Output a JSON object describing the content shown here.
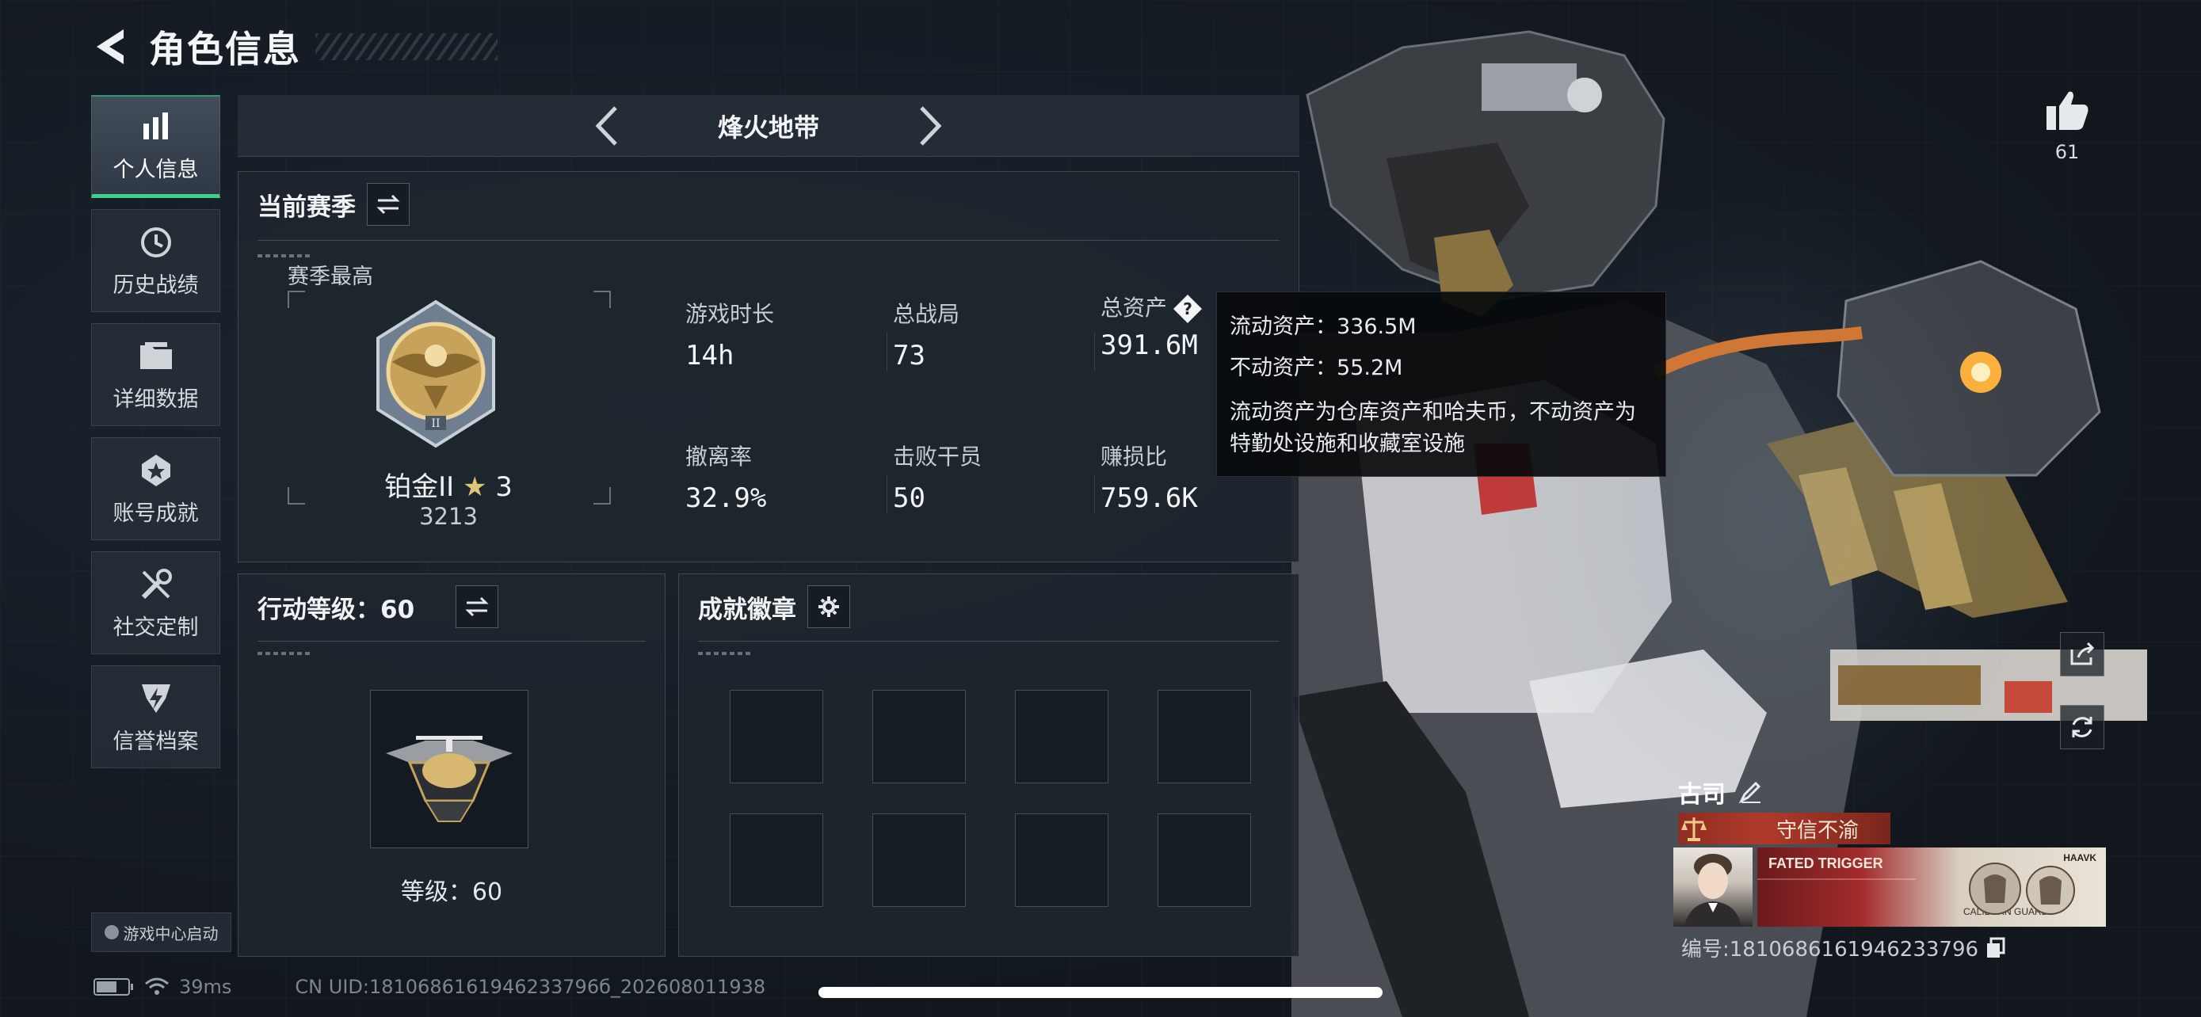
{
  "header": {
    "title": "角色信息"
  },
  "sidebar": {
    "items": [
      {
        "label": "个人信息",
        "icon": "bar-chart-icon",
        "active": true
      },
      {
        "label": "历史战绩",
        "icon": "history-clock-icon"
      },
      {
        "label": "详细数据",
        "icon": "folder-icon"
      },
      {
        "label": "账号成就",
        "icon": "achievement-icon"
      },
      {
        "label": "社交定制",
        "icon": "tools-icon"
      },
      {
        "label": "信誉档案",
        "icon": "lightning-shield-icon"
      }
    ],
    "launch_label": "游戏中心启动"
  },
  "mode_selector": {
    "current": "烽火地带"
  },
  "season_panel": {
    "title": "当前赛季",
    "best_label": "赛季最高",
    "rank_name": "铂金II",
    "rank_stars": "3",
    "rank_score": "3213",
    "stats": [
      {
        "label": "游戏时长",
        "value": "14h"
      },
      {
        "label": "总战局",
        "value": "73"
      },
      {
        "label": "总资产",
        "value": "391.6M"
      },
      {
        "label": "撤离率",
        "value": "32.9%"
      },
      {
        "label": "击败干员",
        "value": "50"
      },
      {
        "label": "赚损比",
        "value": "759.6K"
      }
    ]
  },
  "asset_tooltip": {
    "liquid": "流动资产：336.5M",
    "fixed": "不动资产：55.2M",
    "description": "流动资产为仓库资产和哈夫币，不动资产为特勤处设施和收藏室设施"
  },
  "level_panel": {
    "title": "行动等级：60",
    "level_text": "等级：60"
  },
  "badge_panel": {
    "title": "成就徽章",
    "slots": 8
  },
  "likes": {
    "count": "61"
  },
  "player": {
    "name": "古司",
    "title": "守信不渝",
    "id_text": "编号:1810686161946233796",
    "nameplate_text": "FATED TRIGGER",
    "nameplate_sub": "CALIBURN GUARD",
    "nameplate_brand": "HAAVK"
  },
  "status": {
    "ping": "39ms",
    "uid": "CN UID:1810686161946233796б_202608011938"
  },
  "colors": {
    "accent": "#3ccf8e",
    "title_badge": "#b03a2a"
  }
}
